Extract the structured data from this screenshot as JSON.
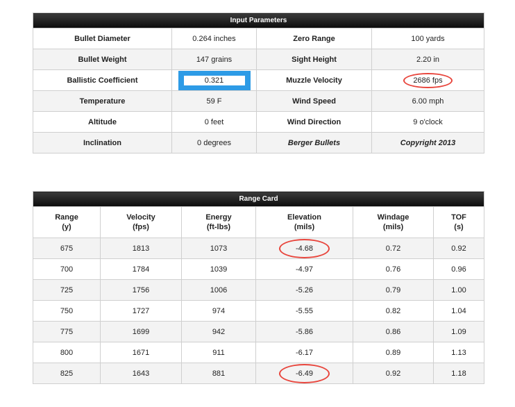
{
  "input": {
    "title": "Input Parameters",
    "rows": [
      {
        "l1": "Bullet Diameter",
        "v1": "0.264 inches",
        "l2": "Zero Range",
        "v2": "100 yards"
      },
      {
        "l1": "Bullet Weight",
        "v1": "147 grains",
        "l2": "Sight Height",
        "v2": "2.20 in"
      },
      {
        "l1": "Ballistic Coefficient",
        "v1": "0.321",
        "l2": "Muzzle Velocity",
        "v2": "2686 fps"
      },
      {
        "l1": "Temperature",
        "v1": "59 F",
        "l2": "Wind Speed",
        "v2": "6.00 mph"
      },
      {
        "l1": "Altitude",
        "v1": "0 feet",
        "l2": "Wind Direction",
        "v2": "9 o'clock"
      },
      {
        "l1": "Inclination",
        "v1": "0 degrees",
        "l2": "Berger Bullets",
        "v2": "Copyright 2013"
      }
    ]
  },
  "range": {
    "title": "Range Card",
    "headers": [
      {
        "top": "Range",
        "bottom": "(y)"
      },
      {
        "top": "Velocity",
        "bottom": "(fps)"
      },
      {
        "top": "Energy",
        "bottom": "(ft-lbs)"
      },
      {
        "top": "Elevation",
        "bottom": "(mils)"
      },
      {
        "top": "Windage",
        "bottom": "(mils)"
      },
      {
        "top": "TOF",
        "bottom": "(s)"
      }
    ],
    "rows": [
      [
        "675",
        "1813",
        "1073",
        "-4.68",
        "0.72",
        "0.92"
      ],
      [
        "700",
        "1784",
        "1039",
        "-4.97",
        "0.76",
        "0.96"
      ],
      [
        "725",
        "1756",
        "1006",
        "-5.26",
        "0.79",
        "1.00"
      ],
      [
        "750",
        "1727",
        "974",
        "-5.55",
        "0.82",
        "1.04"
      ],
      [
        "775",
        "1699",
        "942",
        "-5.86",
        "0.86",
        "1.09"
      ],
      [
        "800",
        "1671",
        "911",
        "-6.17",
        "0.89",
        "1.13"
      ],
      [
        "825",
        "1643",
        "881",
        "-6.49",
        "0.92",
        "1.18"
      ]
    ]
  },
  "colors": {
    "highlight_blue": "#2d9be6",
    "circle_red": "#e8453c"
  }
}
